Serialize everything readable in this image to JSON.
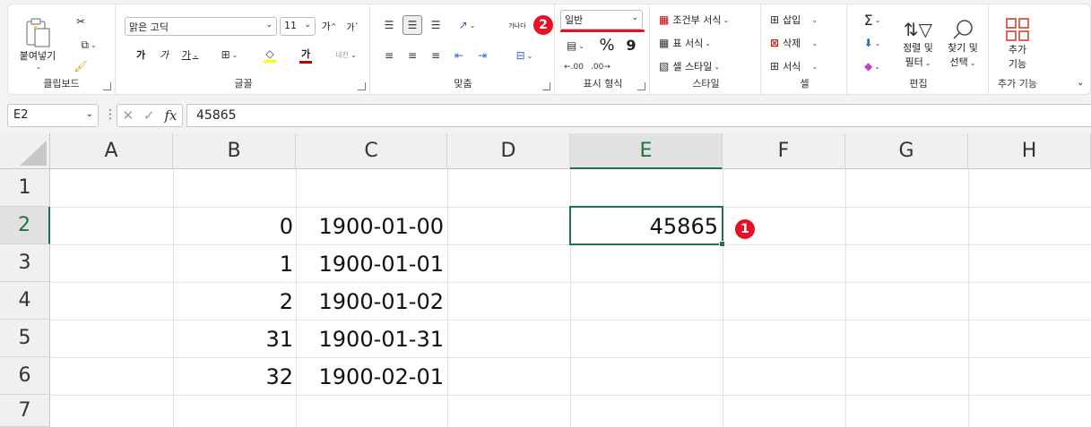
{
  "clipboard": {
    "paste_label": "붙여넣기",
    "group_label": "클립보드"
  },
  "font": {
    "name": "맑은 고딕",
    "size": "11",
    "bold": "가",
    "italic": "가",
    "underline": "가",
    "group_label": "글꼴",
    "grow": "가",
    "shrink": "가",
    "font_color": "가",
    "phonetic": "내천"
  },
  "alignment": {
    "group_label": "맞춤",
    "wrap": "가나다"
  },
  "number": {
    "format": "일반",
    "percent": "%",
    "comma": "9",
    "group_label": "표시 형식"
  },
  "styles": {
    "conditional": "조건부 서식",
    "table": "표 서식",
    "cell": "셀 스타일",
    "group_label": "스타일"
  },
  "cells": {
    "insert": "삽입",
    "delete": "삭제",
    "format": "서식",
    "group_label": "셀"
  },
  "editing": {
    "sum": "Σ",
    "sort_label_1": "정렬 및",
    "sort_label_2": "필터",
    "find_label_1": "찾기 및",
    "find_label_2": "선택",
    "group_label": "편집"
  },
  "addins": {
    "label_1": "추가",
    "label_2": "기능",
    "group_label": "추가 기능"
  },
  "formula_bar": {
    "name_box": "E2",
    "fx": "fx",
    "value": "45865"
  },
  "columns": [
    "A",
    "B",
    "C",
    "D",
    "E",
    "F",
    "G",
    "H"
  ],
  "rows": [
    "1",
    "2",
    "3",
    "4",
    "5",
    "6",
    "7"
  ],
  "cell_values": {
    "B2": "0",
    "C2": "1900-01-00",
    "B3": "1",
    "C3": "1900-01-01",
    "B4": "2",
    "C4": "1900-01-02",
    "B5": "31",
    "C5": "1900-01-31",
    "B6": "32",
    "C6": "1900-02-01",
    "E2": "45865"
  },
  "badges": {
    "one": "1",
    "two": "2"
  },
  "colors": {
    "accent_green": "#217346",
    "badge_red": "#e81123",
    "font_red": "#c00000",
    "highlight_yellow": "#ffff00"
  }
}
